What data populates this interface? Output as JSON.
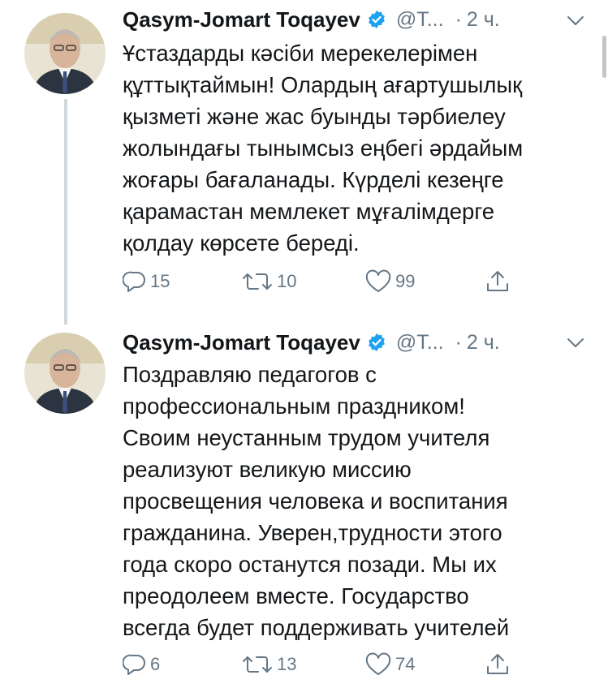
{
  "tweets": [
    {
      "author_name": "Qasym-Jomart Toqayev",
      "handle": "@T...",
      "separator": "·",
      "time": "2 ч.",
      "text": "Ұстаздарды кәсіби мерекелерімен\nқұттықтаймын! Олардың ағартушылық\nқызметі және жас буынды тәрбиелеу\nжолындағы тынымсыз еңбегі әрдайым\nжоғары бағаланады. Күрделі кезеңге\nқарамастан мемлекет мұғалімдерге\nқолдау көрсете береді.",
      "replies": "15",
      "retweets": "10",
      "likes": "99"
    },
    {
      "author_name": "Qasym-Jomart Toqayev",
      "handle": "@T...",
      "separator": "·",
      "time": "2 ч.",
      "text": "Поздравляю педагогов с\nпрофессиональным праздником!\nСвоим неустанным трудом учителя\nреализуют великую миссию\nпросвещения человека и воспитания\nгражданина. Уверен,трудности этого\nгода скоро останутся позади. Мы их\nпреодолеем вместе. Государство\nвсегда будет поддерживать учителей",
      "replies": "6",
      "retweets": "13",
      "likes": "74"
    }
  ],
  "colors": {
    "text": "#14171a",
    "secondary": "#657786",
    "verified": "#1da1f2",
    "thread_line": "#cfd9de"
  },
  "icons": {
    "reply": "reply-icon",
    "retweet": "retweet-icon",
    "like": "heart-icon",
    "share": "share-icon",
    "verified": "verified-badge-icon",
    "more": "chevron-down-icon"
  }
}
